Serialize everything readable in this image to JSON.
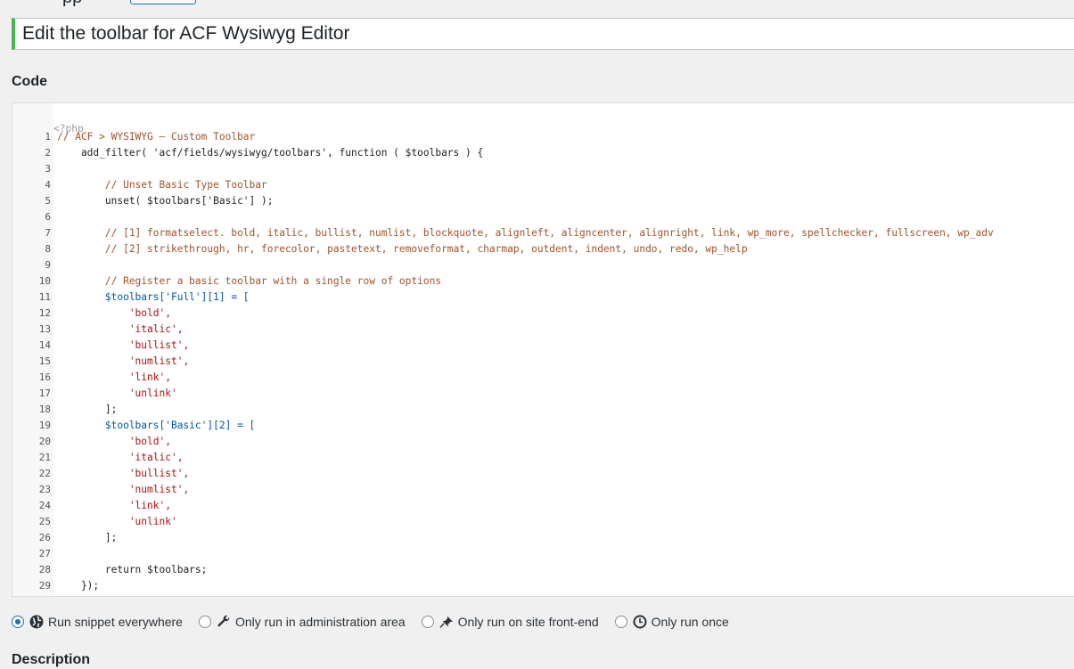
{
  "page": {
    "top_fragment": "pp",
    "title_value": "Edit the toolbar for ACF Wysiwyg Editor",
    "code_heading": "Code",
    "description_heading": "Description"
  },
  "code": {
    "header": "<?php",
    "lines": [
      {
        "n": "1",
        "t": "// ACF > WYSIWYG – Custom Toolbar",
        "c": "c-com"
      },
      {
        "n": "2",
        "t": "    add_filter( 'acf/fields/wysiwyg/toolbars', function ( $toolbars ) {",
        "c": "c-plain"
      },
      {
        "n": "3",
        "t": "",
        "c": "c-plain"
      },
      {
        "n": "4",
        "t": "        // Unset Basic Type Toolbar",
        "c": "c-com"
      },
      {
        "n": "5",
        "t": "        unset( $toolbars['Basic'] );",
        "c": "c-plain"
      },
      {
        "n": "6",
        "t": "",
        "c": "c-plain"
      },
      {
        "n": "7",
        "t": "        // [1] formatselect. bold, italic, bullist, numlist, blockquote, alignleft, aligncenter, alignright, link, wp_more, spellchecker, fullscreen, wp_adv",
        "c": "c-com"
      },
      {
        "n": "8",
        "t": "        // [2] strikethrough, hr, forecolor, pastetext, removeformat, charmap, outdent, indent, undo, redo, wp_help",
        "c": "c-com"
      },
      {
        "n": "9",
        "t": "",
        "c": "c-plain"
      },
      {
        "n": "10",
        "t": "        // Register a basic toolbar with a single row of options",
        "c": "c-com"
      },
      {
        "n": "11",
        "t": "        $toolbars['Full'][1] = [",
        "c": "c-var"
      },
      {
        "n": "12",
        "t": "            'bold',",
        "c": "c-str"
      },
      {
        "n": "13",
        "t": "            'italic',",
        "c": "c-str"
      },
      {
        "n": "14",
        "t": "            'bullist',",
        "c": "c-str"
      },
      {
        "n": "15",
        "t": "            'numlist',",
        "c": "c-str"
      },
      {
        "n": "16",
        "t": "            'link',",
        "c": "c-str"
      },
      {
        "n": "17",
        "t": "            'unlink'",
        "c": "c-str"
      },
      {
        "n": "18",
        "t": "        ];",
        "c": "c-plain"
      },
      {
        "n": "19",
        "t": "        $toolbars['Basic'][2] = [",
        "c": "c-var"
      },
      {
        "n": "20",
        "t": "            'bold',",
        "c": "c-str"
      },
      {
        "n": "21",
        "t": "            'italic',",
        "c": "c-str"
      },
      {
        "n": "22",
        "t": "            'bullist',",
        "c": "c-str"
      },
      {
        "n": "23",
        "t": "            'numlist',",
        "c": "c-str"
      },
      {
        "n": "24",
        "t": "            'link',",
        "c": "c-str"
      },
      {
        "n": "25",
        "t": "            'unlink'",
        "c": "c-str"
      },
      {
        "n": "26",
        "t": "        ];",
        "c": "c-plain"
      },
      {
        "n": "27",
        "t": "",
        "c": "c-plain"
      },
      {
        "n": "28",
        "t": "        return $toolbars;",
        "c": "c-plain"
      },
      {
        "n": "29",
        "t": "    });",
        "c": "c-plain"
      }
    ]
  },
  "run_options": [
    {
      "label": "Run snippet everywhere",
      "icon": "globe-icon",
      "checked": true
    },
    {
      "label": "Only run in administration area",
      "icon": "wrench-icon",
      "checked": false
    },
    {
      "label": "Only run on site front-end",
      "icon": "pin-icon",
      "checked": false
    },
    {
      "label": "Only run once",
      "icon": "clock-icon",
      "checked": false
    }
  ],
  "colors": {
    "accent": "#2271b1",
    "title_bar": "#46b450"
  }
}
